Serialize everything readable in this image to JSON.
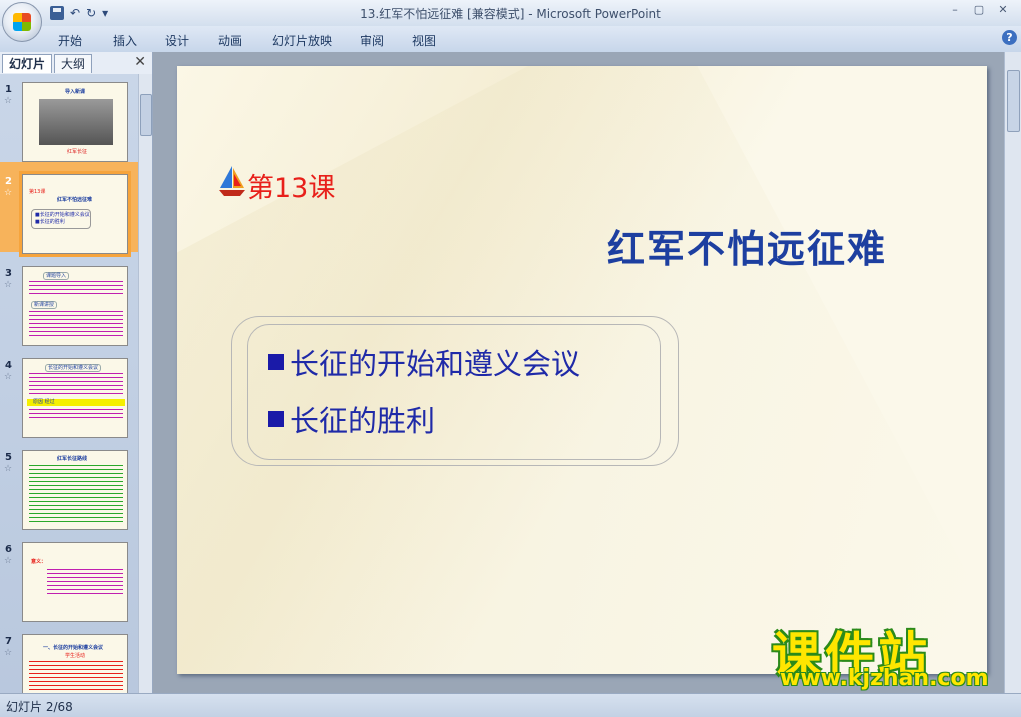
{
  "window": {
    "title": "13.红军不怕远征难 [兼容模式] - Microsoft PowerPoint",
    "controls": [
      "–",
      "▢",
      "✕"
    ]
  },
  "ribbon": {
    "tabs": [
      "开始",
      "插入",
      "设计",
      "动画",
      "幻灯片放映",
      "审阅",
      "视图"
    ],
    "help": "?"
  },
  "panel": {
    "tab_slides": "幻灯片",
    "tab_outline": "大纲",
    "close": "✕",
    "thumbs": [
      {
        "num": "1",
        "title": "导入新课",
        "sub": "红军长征"
      },
      {
        "num": "2",
        "title": "红军不怕远征难",
        "sub": "第13课",
        "line1": "■长征的开始和遵义会议",
        "line2": "■长征的胜利"
      },
      {
        "num": "3",
        "title": "课题导入",
        "sub": "新课讲授"
      },
      {
        "num": "4",
        "title": "长征的开始和遵义会议",
        "sub": "原因  经过"
      },
      {
        "num": "5",
        "title": "红军长征路线",
        "sub": "时间 地点 意义"
      },
      {
        "num": "6",
        "title": "意义：",
        "sub": ""
      },
      {
        "num": "7",
        "title": "一、长征的开始和遵义会议",
        "sub": "学生活动"
      }
    ]
  },
  "slide": {
    "lesson": "第13课",
    "title": "红军不怕远征难",
    "bullets": [
      "长征的开始和遵义会议",
      "长征的胜利"
    ]
  },
  "status": {
    "text": "幻灯片 2/68"
  },
  "watermark": {
    "line1": "课件站",
    "line2": "www.kjzhan.com"
  }
}
